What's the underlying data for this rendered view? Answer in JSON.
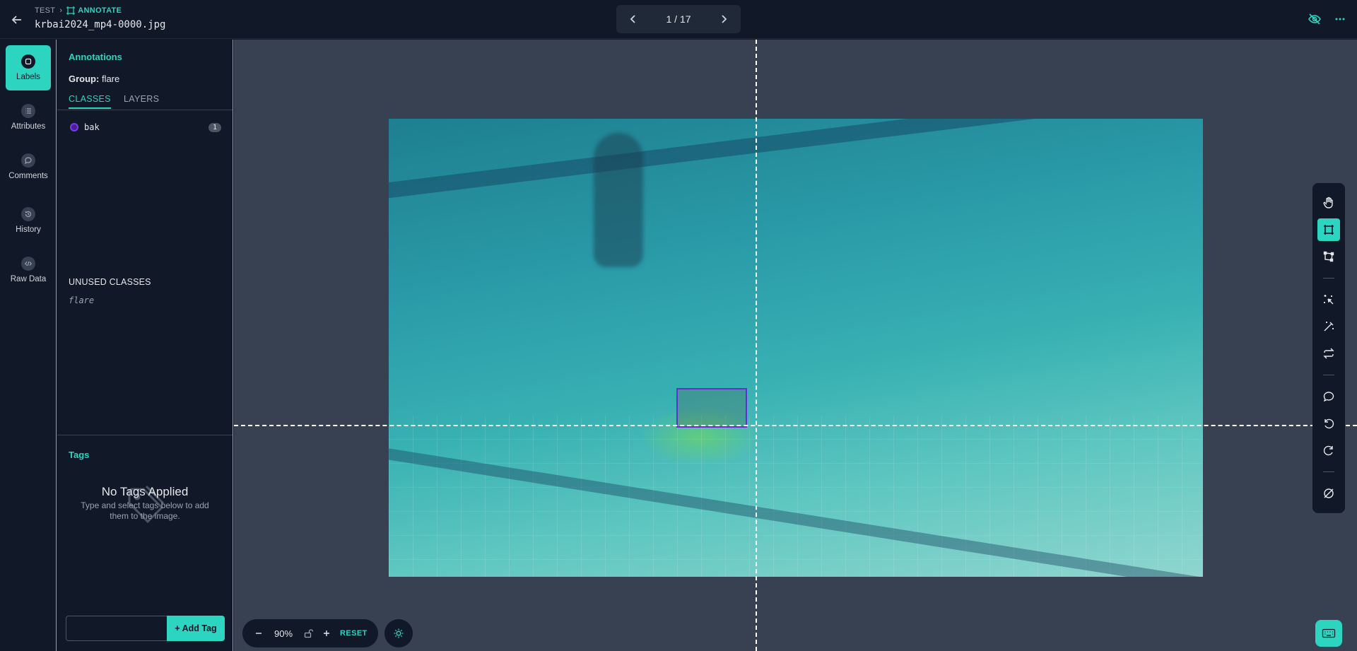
{
  "header": {
    "breadcrumb_root": "TEST",
    "breadcrumb_current": "ANNOTATE",
    "filename": "krbai2024_mp4-0000.jpg",
    "pager": "1 / 17"
  },
  "nav": {
    "items": [
      {
        "label": "Labels",
        "icon": "label-icon",
        "active": true
      },
      {
        "label": "Attributes",
        "icon": "list-icon"
      },
      {
        "label": "Comments",
        "icon": "comment-icon"
      },
      {
        "label": "History",
        "icon": "history-icon"
      },
      {
        "label": "Raw Data",
        "icon": "code-icon"
      }
    ]
  },
  "panel": {
    "title": "Annotations",
    "group_label": "Group:",
    "group_value": "flare",
    "tabs": [
      "CLASSES",
      "LAYERS"
    ],
    "classes": [
      {
        "name": "bak",
        "count": "1",
        "color": "#7c3aed"
      }
    ],
    "unused_title": "UNUSED CLASSES",
    "unused_classes": [
      "flare"
    ],
    "tags_title": "Tags",
    "no_tags_title": "No Tags Applied",
    "no_tags_sub": "Type and select tags below to add them to the image.",
    "add_tag_label": "Add Tag"
  },
  "zoom": {
    "value": "90%",
    "reset_label": "RESET"
  },
  "colors": {
    "accent": "#2dd4bf",
    "bbox": "#6d28d9"
  }
}
